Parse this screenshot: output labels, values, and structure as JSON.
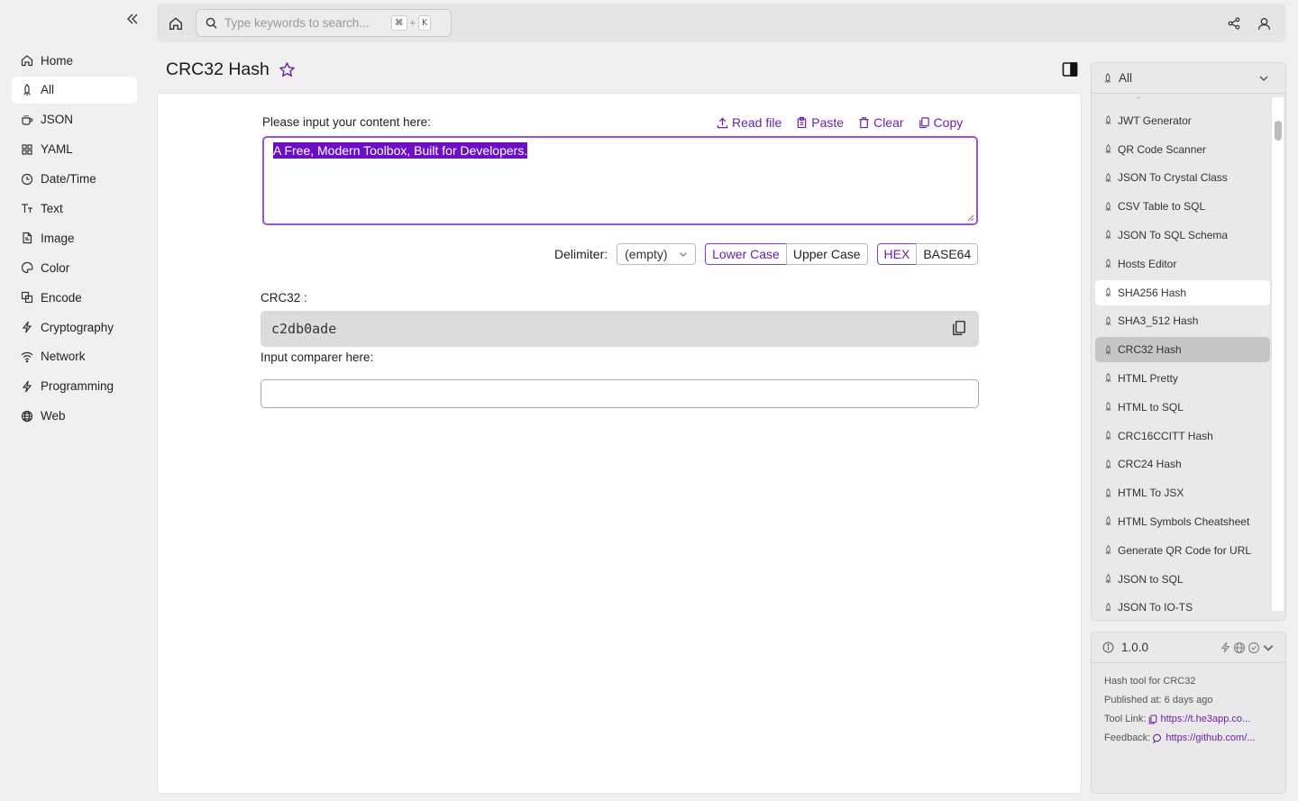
{
  "sidebar": {
    "items": [
      {
        "label": "Home",
        "icon": "home-icon"
      },
      {
        "label": "All",
        "icon": "rocket-icon"
      },
      {
        "label": "JSON",
        "icon": "cup-icon"
      },
      {
        "label": "YAML",
        "icon": "grid-icon"
      },
      {
        "label": "Date/Time",
        "icon": "clock-icon"
      },
      {
        "label": "Text",
        "icon": "text-icon"
      },
      {
        "label": "Image",
        "icon": "image-icon"
      },
      {
        "label": "Color",
        "icon": "palette-icon"
      },
      {
        "label": "Encode",
        "icon": "encode-icon"
      },
      {
        "label": "Cryptography",
        "icon": "lightning-icon"
      },
      {
        "label": "Network",
        "icon": "wifi-icon"
      },
      {
        "label": "Programming",
        "icon": "lightning-icon"
      },
      {
        "label": "Web",
        "icon": "globe-icon"
      }
    ]
  },
  "header": {
    "search_placeholder": "Type keywords to search...",
    "kbd_cmd": "⌘",
    "kbd_plus": "+",
    "kbd_k": "K"
  },
  "page": {
    "title": "CRC32 Hash"
  },
  "main": {
    "input_label": "Please input your content here:",
    "actions": {
      "read_file": "Read file",
      "paste": "Paste",
      "clear": "Clear",
      "copy": "Copy"
    },
    "input_value": "A Free, Modern Toolbox, Built for Developers.",
    "delimiter_label": "Delimiter:",
    "delimiter_value": "(empty)",
    "case_lower": "Lower Case",
    "case_upper": "Upper Case",
    "format_hex": "HEX",
    "format_base64": "BASE64",
    "output_label": "CRC32 :",
    "output_value": "c2db0ade",
    "comparer_label": "Input comparer here:",
    "comparer_value": ""
  },
  "right_panel": {
    "filter": "All",
    "items": [
      "Image to Icon",
      "JWT Generator",
      "QR Code Scanner",
      "JSON To Crystal Class",
      "CSV Table to SQL",
      "JSON To SQL Schema",
      "Hosts Editor",
      "SHA256 Hash",
      "SHA3_512 Hash",
      "CRC32 Hash",
      "HTML Pretty",
      "HTML to SQL",
      "CRC16CCITT Hash",
      "CRC24 Hash",
      "HTML To JSX",
      "HTML Symbols Cheatsheet",
      "Generate QR Code for URL",
      "JSON to SQL",
      "JSON To IO-TS"
    ],
    "hover_index": 7,
    "active_index": 9
  },
  "info": {
    "version": "1.0.0",
    "description": "Hash tool for CRC32",
    "published": "Published at: 6 days ago",
    "tool_link_label": "Tool Link:",
    "tool_link": "https://t.he3app.co...",
    "feedback_label": "Feedback:",
    "feedback_link": "https://github.com/..."
  },
  "colors": {
    "accent": "#6b21a8",
    "selection": "#6b0fc7",
    "border_focus": "#9b51e0"
  }
}
